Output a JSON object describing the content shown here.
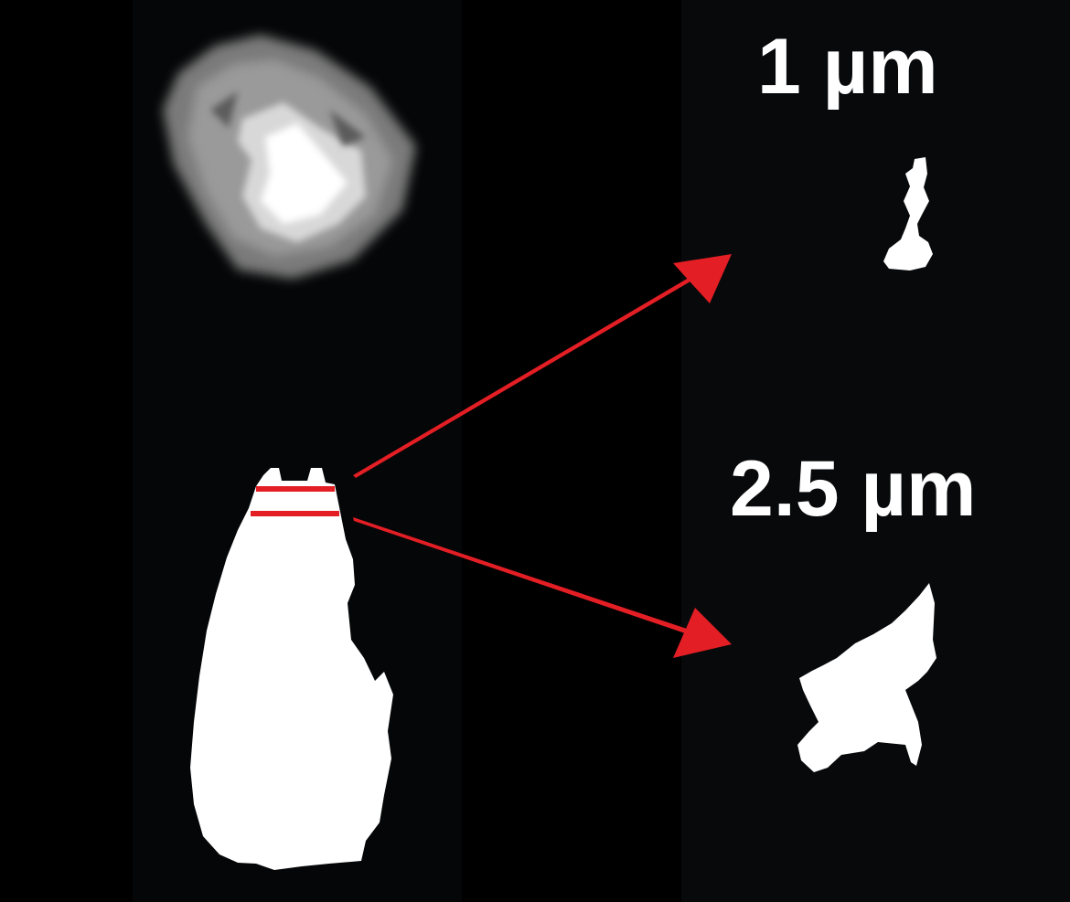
{
  "labels": {
    "top_slice": "1 µm",
    "bottom_slice": "2.5 µm"
  },
  "colors": {
    "background": "#000000",
    "particle": "#ffffff",
    "annotation": "#e31e24"
  }
}
